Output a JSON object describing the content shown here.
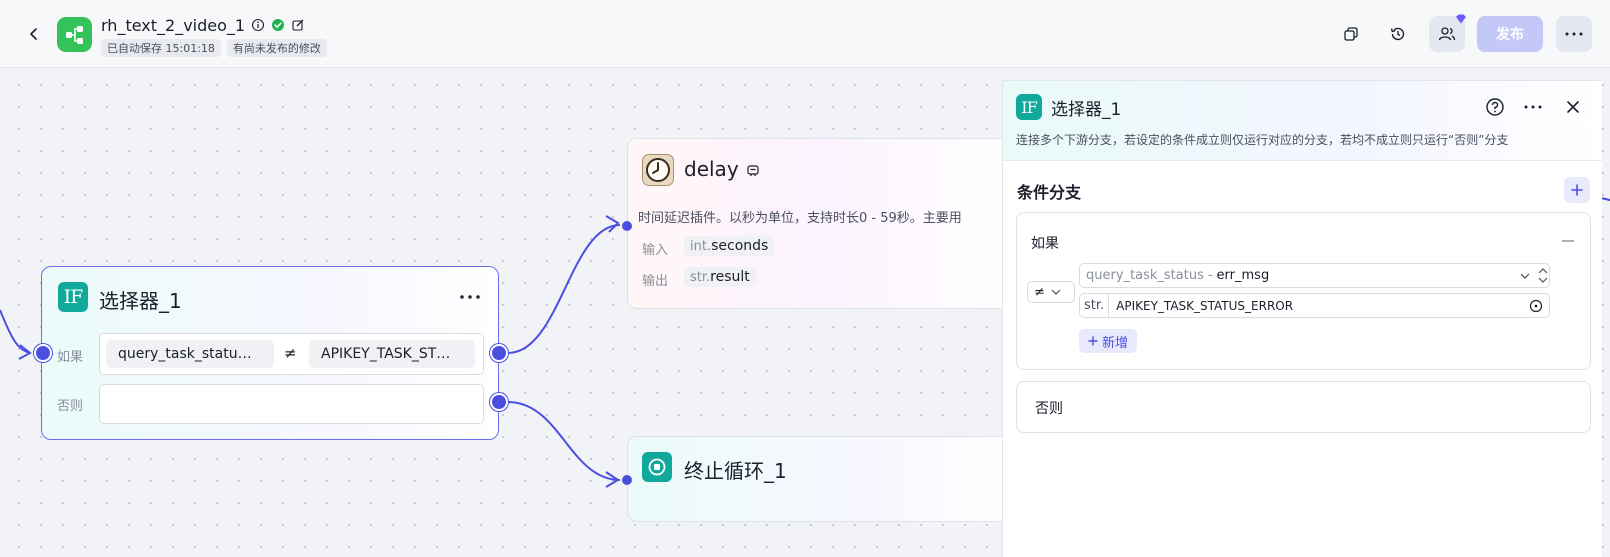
{
  "header": {
    "title": "rh_text_2_video_1",
    "autosave": "已自动保存 15:01:18",
    "unpublished": "有尚未发布的修改",
    "publish_label": "发布"
  },
  "nodes": {
    "delay": {
      "title": "delay",
      "description": "时间延迟插件。以秒为单位，支持时长0 - 59秒。主要用",
      "input_label": "输入",
      "input_type": "int.",
      "input_name": "seconds",
      "output_label": "输出",
      "output_type": "str.",
      "output_name": "result"
    },
    "selector": {
      "title": "选择器_1",
      "if_label": "如果",
      "left_operand": "query_task_statu…",
      "operator": "≠",
      "right_operand": "APIKEY_TASK_ST…",
      "else_label": "否则"
    },
    "terminate": {
      "title": "终止循环_1"
    }
  },
  "panel": {
    "title": "选择器_1",
    "description": "连接多个下游分支，若设定的条件成立则仅运行对应的分支，若均不成立则只运行“否则”分支",
    "section_title": "条件分支",
    "if_label": "如果",
    "operator": "≠",
    "left_node": "query_task_status",
    "left_sep": "-",
    "left_field": "err_msg",
    "right_type": "str.",
    "right_value": "APIKEY_TASK_STATUS_ERROR",
    "add_label": "新增",
    "else_label": "否则"
  },
  "colors": {
    "accent": "#4b4fe0",
    "if_icon": "#10a99b",
    "logo": "#35c25a",
    "publish_disabled": "#c3c8f7"
  }
}
